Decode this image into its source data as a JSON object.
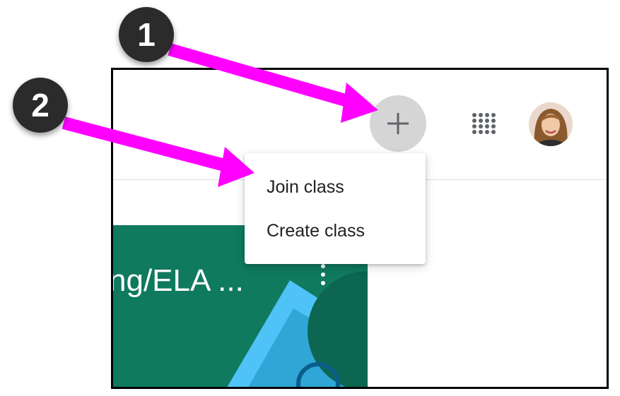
{
  "toolbar": {
    "add_button_icon": "plus-icon",
    "apps_icon": "grid-apps-icon",
    "avatar_icon": "user-avatar"
  },
  "menu": {
    "items": [
      {
        "label": "Join class"
      },
      {
        "label": "Create class"
      }
    ]
  },
  "class_card": {
    "title": "ng/ELA ...",
    "menu_icon": "more-vert-icon",
    "color": "#0f7a5e"
  },
  "annotations": {
    "badges": [
      {
        "number": "1"
      },
      {
        "number": "2"
      }
    ],
    "arrow_color": "#ff00ff",
    "badge_color": "#2b2b2b"
  }
}
